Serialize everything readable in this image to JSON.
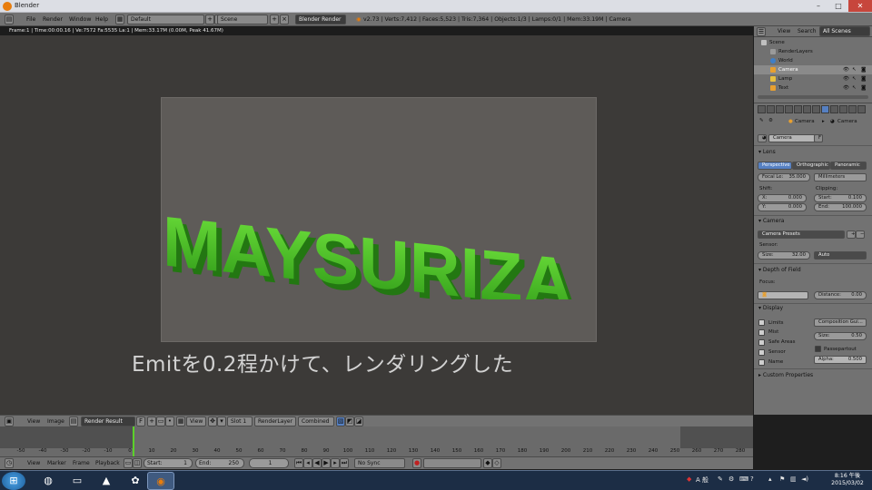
{
  "window": {
    "title": "Blender",
    "min": "–",
    "max": "□",
    "close": "✕"
  },
  "info_header": {
    "menus": [
      "File",
      "Render",
      "Window",
      "Help"
    ],
    "layout": "Default",
    "scene": "Scene",
    "engine": "Blender Render",
    "stats": "v2.73 | Verts:7,412 | Faces:5,523 | Tris:7,364 | Objects:1/3 | Lamps:0/1 | Mem:33.19M | Camera"
  },
  "render": {
    "meta": "Frame:1 | Time:00:00.16 | Ve:7572 Fa:5535 La:1 | Mem:33.17M (0.00M, Peak 41.67M)",
    "logo_text": "MAYSURIZA",
    "logo_color": "#52cc2a",
    "caption": "Emitを0.2程かけて、レンダリングした"
  },
  "image_header": {
    "menus": [
      "View",
      "Image"
    ],
    "image": "Render Result",
    "f_label": "F",
    "view": "View",
    "slot": "Slot 1",
    "layer": "RenderLayer",
    "pass": "Combined"
  },
  "timeline": {
    "ticks": [
      "-50",
      "-40",
      "-30",
      "-20",
      "-10",
      "0",
      "10",
      "20",
      "30",
      "40",
      "50",
      "60",
      "70",
      "80",
      "90",
      "100",
      "110",
      "120",
      "130",
      "140",
      "150",
      "160",
      "170",
      "180",
      "190",
      "200",
      "210",
      "220",
      "230",
      "240",
      "250",
      "260",
      "270",
      "280"
    ],
    "current_frame": 1,
    "menus": [
      "View",
      "Marker",
      "Frame",
      "Playback"
    ],
    "start": "Start:",
    "start_val": "1",
    "end": "End:",
    "end_val": "250",
    "frame_val": "1",
    "sync": "No Sync"
  },
  "outliner": {
    "view": "View",
    "search": "Search",
    "filter": "All Scenes",
    "items": [
      {
        "name": "Scene",
        "color": "#c0c0c0"
      },
      {
        "name": "RenderLayers",
        "color": "#9a9a9a"
      },
      {
        "name": "World",
        "color": "#3f7fc8"
      },
      {
        "name": "Camera",
        "color": "#e8a030"
      },
      {
        "name": "Lamp",
        "color": "#e8c040"
      },
      {
        "name": "Text",
        "color": "#e8a030"
      }
    ]
  },
  "properties": {
    "breadcrumb_a": "Camera",
    "breadcrumb_b": "Camera",
    "datablock": "Camera",
    "f_label": "F",
    "lens": {
      "title": "Lens",
      "modes": [
        "Perspective",
        "Orthographic",
        "Panoramic"
      ],
      "focal_label": "Focal Le:",
      "focal_val": "35.000",
      "units": "Millimeters",
      "shift_label": "Shift:",
      "clipping_label": "Clipping:",
      "x_label": "X:",
      "x_val": "0.000",
      "y_label": "Y:",
      "y_val": "0.000",
      "start_label": "Start:",
      "start_val": "0.100",
      "end_label": "End:",
      "end_val": "100.000"
    },
    "camera": {
      "title": "Camera",
      "presets": "Camera Presets",
      "sensor_label": "Sensor:",
      "size_label": "Size:",
      "size_val": "32.00",
      "fit": "Auto"
    },
    "dof": {
      "title": "Depth of Field",
      "focus_label": "Focus:",
      "distance_label": "Distance:",
      "distance_val": "0.00"
    },
    "display": {
      "title": "Display",
      "checks": [
        "Limits",
        "Mist",
        "Safe Areas",
        "Sensor",
        "Name"
      ],
      "guides": "Composition Gui...",
      "size_label": "Size:",
      "size_val": "0.50",
      "passepartout": "Passepartout",
      "alpha_label": "Alpha:",
      "alpha_val": "0.500"
    },
    "custom": "Custom Properties"
  },
  "taskbar": {
    "time": "8:16 午後",
    "date": "2015/03/02",
    "ime": "A 般"
  }
}
